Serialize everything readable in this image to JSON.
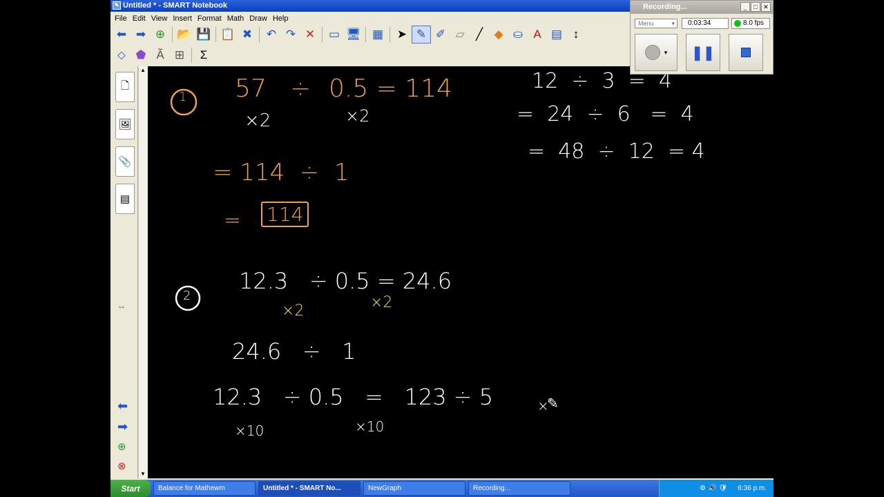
{
  "window": {
    "title": "Untitled * - SMART Notebook",
    "app_icon": "smart-notebook-icon"
  },
  "menu": [
    "File",
    "Edit",
    "View",
    "Insert",
    "Format",
    "Math",
    "Draw",
    "Help"
  ],
  "recorder": {
    "title": "Recording...",
    "menu_label": "Menu",
    "timer": "0:03:34",
    "fps": "8.0 fps",
    "status_color": "#11c111"
  },
  "board": {
    "p1": {
      "circle": "1",
      "line1a": "57",
      "line1b": "÷",
      "line1c": "0.5 = 114",
      "m1": "×2",
      "m2": "×2",
      "line2": "= 114  ÷  1",
      "line3eq": "=",
      "line3box": "114"
    },
    "p2": {
      "circle": "2",
      "line1": "12.3   ÷ 0.5 = 24.6",
      "m1": "×2",
      "m2": "×2",
      "line2": "24.6   ÷   1",
      "line3": "12.3   ÷ 0.5   =   123 ÷ 5",
      "m3": "×10",
      "m4": "×10",
      "m5": "×"
    },
    "side": {
      "r1": "12  ÷  3  =  4",
      "r2": "=  24  ÷  6   =  4",
      "r3": "=  48  ÷  12  = 4"
    }
  },
  "taskbar": {
    "start": "Start",
    "tasks": [
      "Balance for Mathewm",
      "Untitled * - SMART No...",
      "NewGraph",
      "Recording..."
    ],
    "clock": "6:36 p.m."
  },
  "colors": {
    "orange": "#f0a24a",
    "white": "#ffffff",
    "yellow": "#e8e23a"
  }
}
